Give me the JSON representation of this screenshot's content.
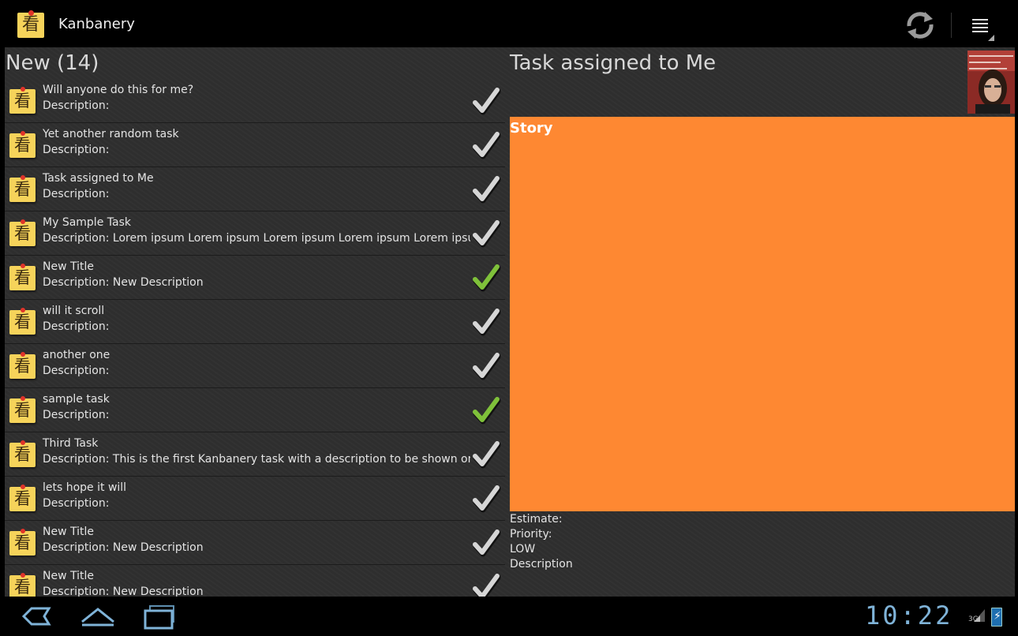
{
  "app": {
    "title": "Kanbanery",
    "icon_glyph": "看"
  },
  "actions": {
    "refresh_icon": "refresh-icon",
    "overflow_icon": "overflow-menu-icon"
  },
  "list": {
    "header": "New (14)",
    "tasks": [
      {
        "title": "Will anyone do this for me?",
        "description": "Description:",
        "check": "gray"
      },
      {
        "title": "Yet another random task",
        "description": "Description:",
        "check": "gray"
      },
      {
        "title": "Task assigned to Me",
        "description": "Description:",
        "check": "gray"
      },
      {
        "title": "My Sample Task",
        "description": "Description: Lorem ipsum Lorem ipsum Lorem ipsum Lorem ipsum Lorem ipsum Lorem",
        "check": "gray"
      },
      {
        "title": "New Title",
        "description": "Description: New Description",
        "check": "green"
      },
      {
        "title": "will it scroll",
        "description": "Description:",
        "check": "gray"
      },
      {
        "title": "another one",
        "description": "Description:",
        "check": "gray"
      },
      {
        "title": "sample task",
        "description": "Description:",
        "check": "green"
      },
      {
        "title": "Third Task",
        "description": "Description: This is the first Kanbanery task with a description to be shown on an andro",
        "check": "gray"
      },
      {
        "title": "lets hope it will",
        "description": "Description:",
        "check": "gray"
      },
      {
        "title": "New Title",
        "description": "Description: New Description",
        "check": "gray"
      },
      {
        "title": "New Title",
        "description": "Description: New Description",
        "check": "gray"
      }
    ]
  },
  "detail": {
    "title": "Task assigned to Me",
    "type": "Story",
    "type_color": "#fe8832",
    "estimate_label": "Estimate:",
    "priority_label": "Priority:",
    "priority_value": "LOW",
    "description_label": "Description"
  },
  "colors": {
    "check_gray": "#d6d6d6",
    "check_green": "#7fc13a",
    "sticky_note": "#f6d35a",
    "clock": "#7fb3d8"
  },
  "system_bar": {
    "time": "10:22",
    "network": "3G"
  }
}
